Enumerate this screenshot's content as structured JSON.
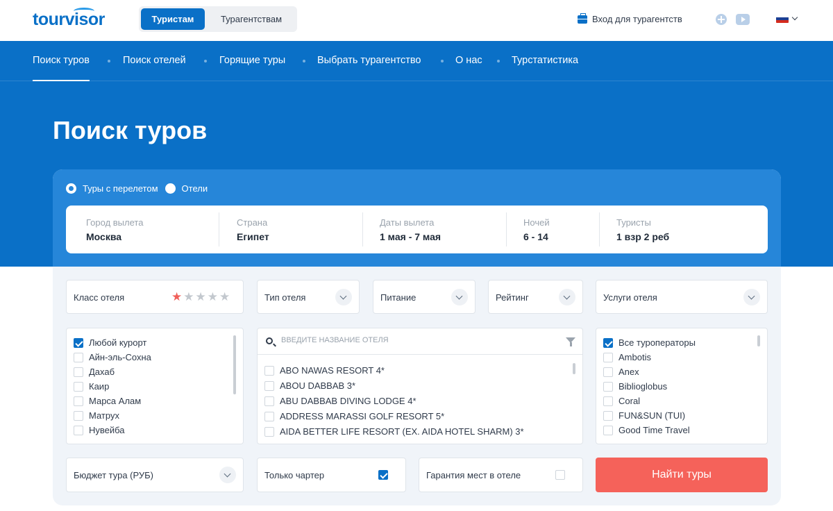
{
  "header": {
    "logo": "tourvisor",
    "segment": {
      "active": "Туристам",
      "inactive": "Турагентствам"
    },
    "agent_login": "Вход для турагентств",
    "flag_colors": [
      "#ffffff",
      "#1c3f94",
      "#d52b1e"
    ]
  },
  "nav": {
    "items": [
      "Поиск туров",
      "Поиск отелей",
      "Горящие туры",
      "Выбрать турагентство",
      "О нас",
      "Турстатистика"
    ],
    "active_index": 0
  },
  "page_title": "Поиск туров",
  "search": {
    "mode_options": [
      "Туры с перелетом",
      "Отели"
    ],
    "mode_selected": "Туры с перелетом",
    "fields": {
      "city": {
        "label": "Город вылета",
        "value": "Москва"
      },
      "country": {
        "label": "Страна",
        "value": "Египет"
      },
      "dates": {
        "label": "Даты вылета",
        "value": "1 мая - 7 мая"
      },
      "nights": {
        "label": "Ночей",
        "value": "6 - 14"
      },
      "tourists": {
        "label": "Туристы",
        "value": "1 взр 2 реб"
      }
    }
  },
  "filters": {
    "hotel_class": {
      "label": "Класс отеля",
      "stars_total": 5,
      "stars_selected": 1
    },
    "hotel_type": "Тип отеля",
    "meal": "Питание",
    "rating": "Рейтинг",
    "services": "Услуги отеля"
  },
  "resorts": [
    {
      "name": "Любой курорт",
      "checked": true
    },
    {
      "name": "Айн-эль-Сохна",
      "checked": false
    },
    {
      "name": "Дахаб",
      "checked": false
    },
    {
      "name": "Каир",
      "checked": false
    },
    {
      "name": "Марса Алам",
      "checked": false
    },
    {
      "name": "Матрух",
      "checked": false
    },
    {
      "name": "Нувейба",
      "checked": false
    }
  ],
  "hotel_search": {
    "placeholder": "ВВЕДИТЕ НАЗВАНИЕ ОТЕЛЯ",
    "hotels": [
      "ABO NAWAS RESORT 4*",
      "ABOU DABBAB 3*",
      "ABU DABBAB DIVING LODGE 4*",
      "ADDRESS MARASSI GOLF RESORT 5*",
      "AIDA BETTER LIFE RESORT (EX. AIDA HOTEL SHARM) 3*"
    ]
  },
  "operators": [
    {
      "name": "Все туроператоры",
      "checked": true
    },
    {
      "name": "Ambotis",
      "checked": false
    },
    {
      "name": "Anex",
      "checked": false
    },
    {
      "name": "Biblioglobus",
      "checked": false
    },
    {
      "name": "Coral",
      "checked": false
    },
    {
      "name": "FUN&SUN (TUI)",
      "checked": false
    },
    {
      "name": "Good Time Travel",
      "checked": false
    }
  ],
  "bottom": {
    "budget": "Бюджет тура (РУБ)",
    "charter_only": {
      "label": "Только чартер",
      "checked": true
    },
    "guarantee": {
      "label": "Гарантия мест в отеле",
      "checked": false
    },
    "find_button": "Найти туры"
  },
  "colors": {
    "primary": "#0a70c7",
    "accent": "#f5625a",
    "panel": "#2686d9"
  }
}
